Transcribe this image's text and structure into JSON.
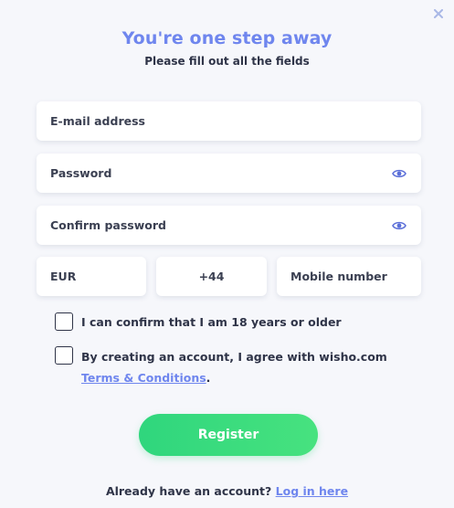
{
  "modal": {
    "title": "You're one step away",
    "subtitle": "Please fill out all the fields"
  },
  "fields": {
    "email_placeholder": "E-mail address",
    "password_placeholder": "Password",
    "confirm_password_placeholder": "Confirm password",
    "currency_value": "EUR",
    "phone_code_value": "+44",
    "mobile_placeholder": "Mobile number"
  },
  "checkboxes": {
    "age_label": "I can confirm that I am 18 years or older",
    "terms_label_prefix": "By creating an account, I agree with wisho.com ",
    "terms_link_text": "Terms & Conditions",
    "terms_label_suffix": "."
  },
  "register_button_label": "Register",
  "footer": {
    "text": "Already have an account? ",
    "login_link_text": "Log in here"
  },
  "colors": {
    "accent": "#6f86ee",
    "button_green": "#38dc7e",
    "text_dark": "#2f3448",
    "background": "#f6f7fb"
  },
  "icons": {
    "close": "close-icon",
    "password_visibility": "eye-icon"
  }
}
